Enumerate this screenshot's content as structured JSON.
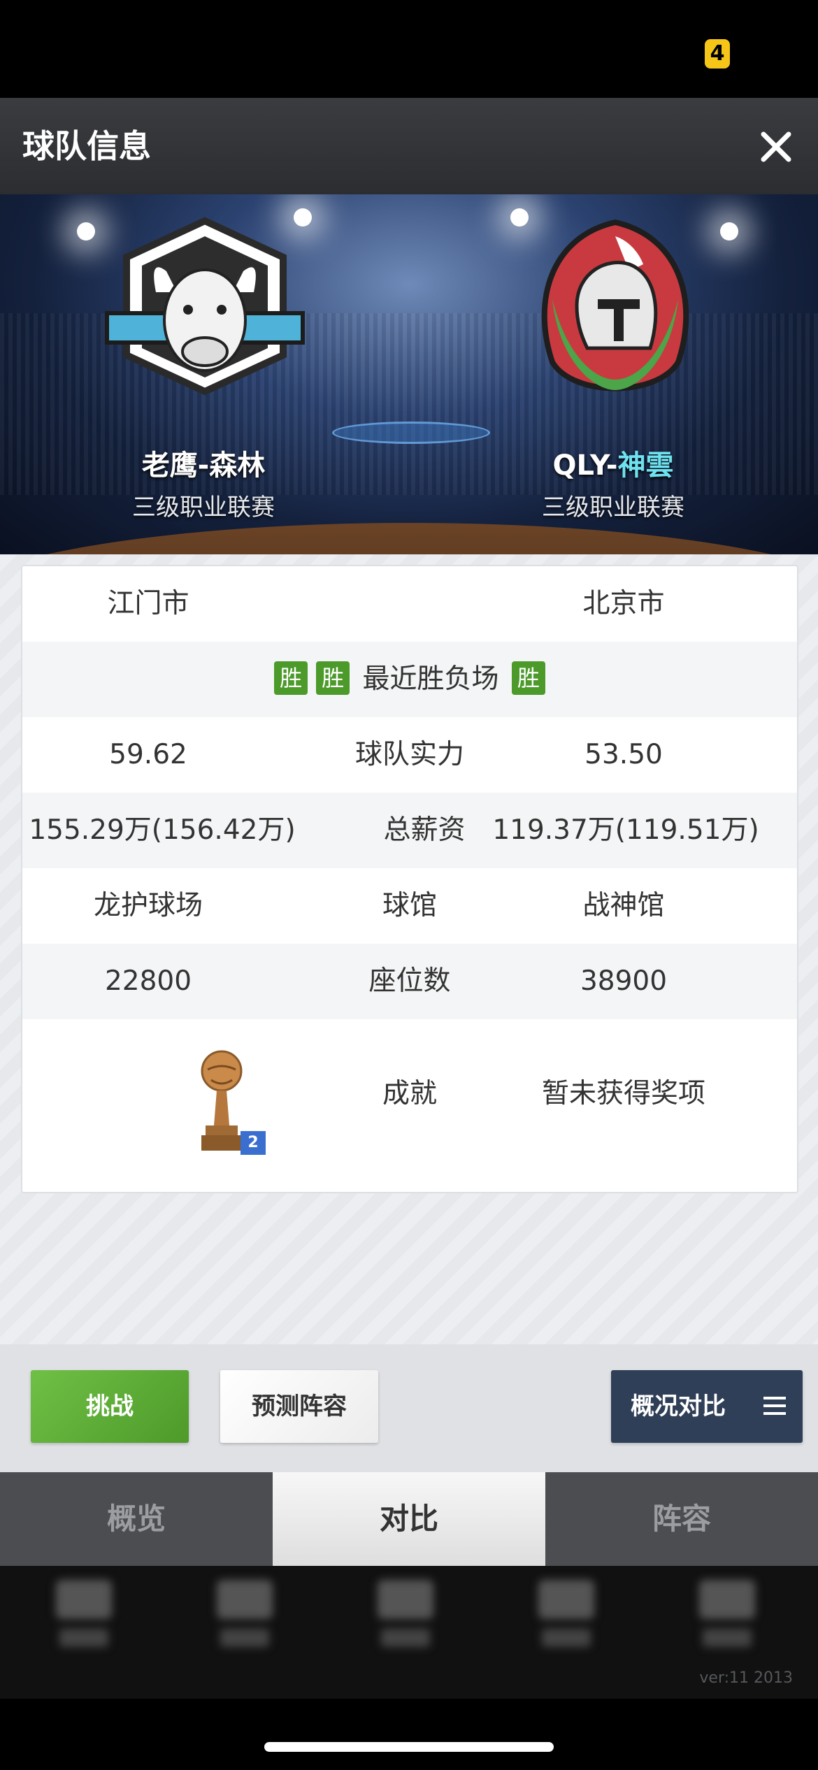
{
  "status_bar": {
    "battery_text": "4"
  },
  "header": {
    "title": "球队信息"
  },
  "teams": {
    "home": {
      "name": "老鹰-森林",
      "league": "三级职业联赛",
      "city": "江门市"
    },
    "away": {
      "name_prefix": "QLY-",
      "name_accent": "神雲",
      "league": "三级职业联赛",
      "city": "北京市"
    }
  },
  "recent": {
    "label": "最近胜负场",
    "home_results": [
      "胜",
      "胜"
    ],
    "away_results": [
      "胜"
    ]
  },
  "stats": [
    {
      "home": "59.62",
      "label": "球队实力",
      "away": "53.50"
    },
    {
      "home": "155.29万(156.42万)",
      "label": "总薪资",
      "away": "119.37万(119.51万)"
    },
    {
      "home": "龙护球场",
      "label": "球馆",
      "away": "战神馆"
    },
    {
      "home": "22800",
      "label": "座位数",
      "away": "38900"
    }
  ],
  "achievement": {
    "label": "成就",
    "home_count": "2",
    "away_value": "暂未获得奖项"
  },
  "actions": {
    "challenge": "挑战",
    "predict": "预测阵容",
    "compare": "概况对比"
  },
  "tabs": [
    {
      "label": "概览"
    },
    {
      "label": "对比"
    },
    {
      "label": "阵容"
    }
  ],
  "active_tab": "对比",
  "version": "ver:11  2013",
  "colors": {
    "win_badge": "#4c9a2a",
    "challenge": "#5aab33",
    "compare_bg": "#2f3f57",
    "accent_name": "#6fe2f2"
  }
}
